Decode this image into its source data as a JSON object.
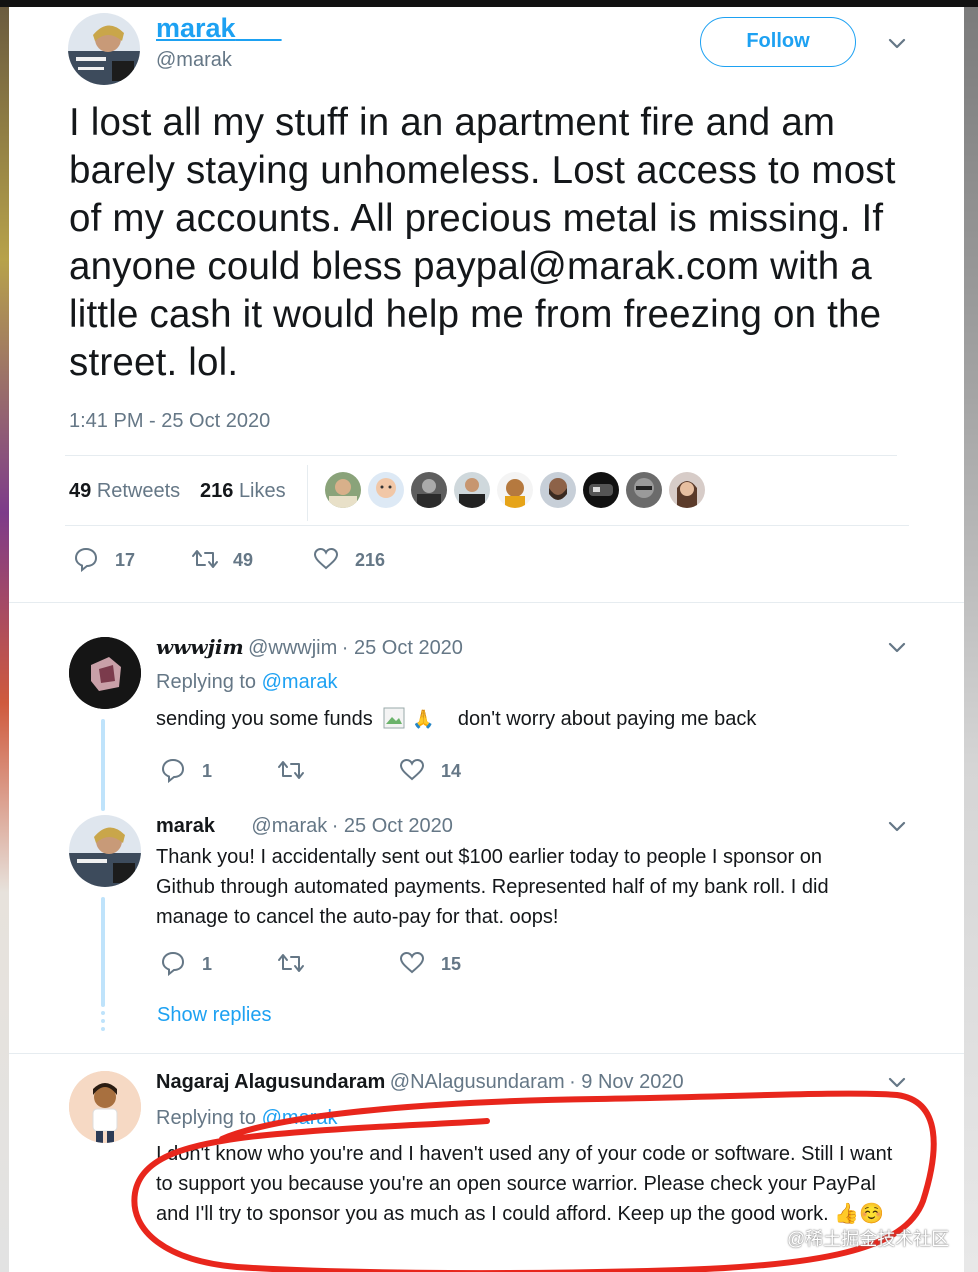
{
  "main_tweet": {
    "display_name": "marak",
    "handle": "@marak",
    "follow_label": "Follow",
    "text": "I lost all my stuff in an apartment fire and am barely staying unhomeless. Lost access to most of my accounts. All precious metal is missing. If anyone could bless paypal@marak.com with a little cash it would help me from freezing on the street. lol.",
    "timestamp": "1:41 PM - 25 Oct 2020",
    "retweets_count": "49",
    "retweets_label": "Retweets",
    "likes_count": "216",
    "likes_label": "Likes",
    "actions": {
      "replies": "17",
      "retweets": "49",
      "likes": "216"
    }
  },
  "replies": [
    {
      "display_name": "wwwjim",
      "handle": "@wwwjim",
      "date": "· 25 Oct 2020",
      "replying_prefix": "Replying to",
      "replying_to": "@marak",
      "text_before": "sending you some funds",
      "text_after": "don't worry about paying me back",
      "actions": {
        "replies": "1",
        "likes": "14"
      }
    },
    {
      "display_name": "marak",
      "handle": "@marak",
      "date": "· 25 Oct 2020",
      "text": "Thank you! I accidentally sent out $100 earlier today to people I sponsor on Github through automated payments. Represented half of my bank roll. I did manage to cancel the auto-pay for that. oops!",
      "actions": {
        "replies": "1",
        "likes": "15"
      }
    },
    {
      "display_name": "Nagaraj Alagusundaram",
      "handle": "@NAlagusundaram",
      "date": "· 9 Nov 2020",
      "replying_prefix": "Replying to",
      "replying_to": "@marak",
      "text": "I don't know who you're and I haven't used any of your code or software. Still I want to support you because you're an open source warrior. Please check your PayPal and I'll try to sponsor you as much as I could afford. Keep up the good work.",
      "emoji": "👍☺️"
    }
  ],
  "show_replies_label": "Show replies",
  "watermark": "@稀土掘金技术社区",
  "colors": {
    "accent": "#1da1f2",
    "annotation": "#e8261c"
  }
}
